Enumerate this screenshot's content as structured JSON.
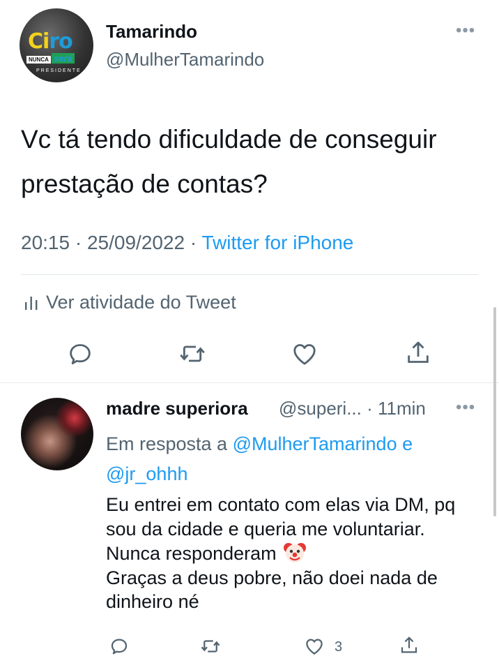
{
  "main_tweet": {
    "author_name": "Tamarindo",
    "author_handle": "@MulherTamarindo",
    "avatar_logo": {
      "line1a": "Ci",
      "line1b": "ro",
      "nunca": "NUNCA",
      "sera": "será",
      "presidente": "PRESIDENTE"
    },
    "more_label": "•••",
    "text": "Vc tá tendo dificuldade de conseguir prestação de contas?",
    "time": "20:15",
    "date": "25/09/2022",
    "separator": " · ",
    "source": "Twitter for iPhone",
    "activity_label": "Ver atividade do Tweet"
  },
  "reply": {
    "author_name": "madre superiora",
    "author_handle": "@superi...",
    "time_ago": "· 11min",
    "more_label": "•••",
    "reply_prefix": "Em resposta a",
    "reply_to_1": "@MulherTamarindo",
    "reply_conj": "e",
    "reply_to_2": "@jr_ohhh",
    "text_part1": "Eu entrei em contato com elas via DM, pq sou da cidade e queria me voluntariar. Nunca responderam",
    "text_part2": "Graças a deus pobre, não doei nada de dinheiro né",
    "like_count": "3"
  },
  "icons": {
    "reply": "speech-bubble-icon",
    "retweet": "retweet-arrows-icon",
    "like": "heart-icon",
    "share": "share-upload-icon",
    "activity": "bar-chart-icon",
    "emoji": "clown-face-emoji"
  },
  "colors": {
    "link": "#1d9bf0",
    "secondary_text": "#536471",
    "primary_text": "#0f1419",
    "icon": "#536471"
  }
}
